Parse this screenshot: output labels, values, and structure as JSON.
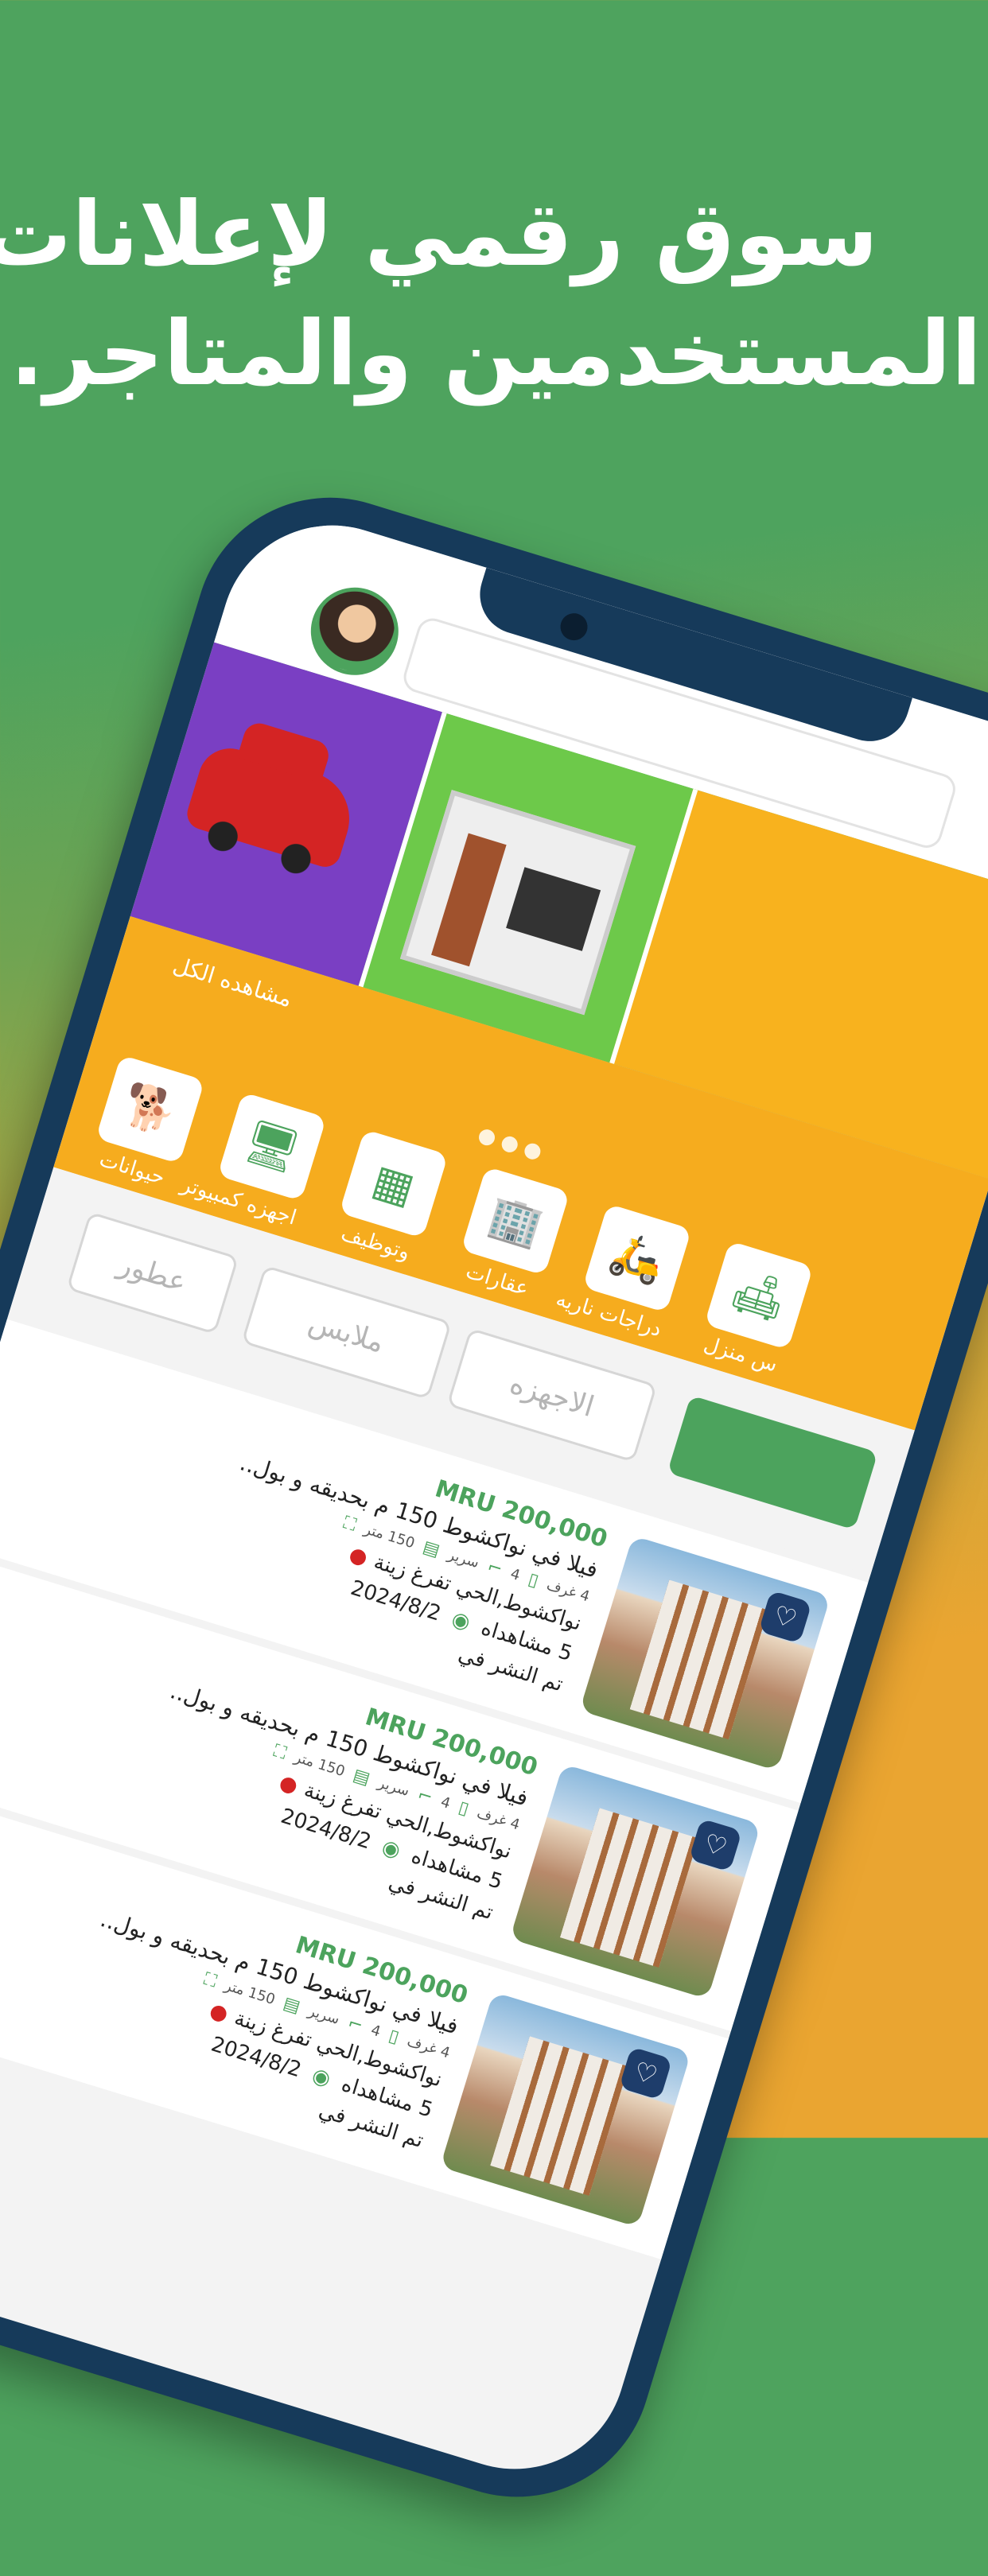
{
  "headline": {
    "line1": "سوق رقمي لإعلانات",
    "line2": "المستخدمين والمتاجر."
  },
  "colors": {
    "brand_green": "#4ca35d",
    "accent_orange": "#f6ac1e",
    "heart_navy": "#1e3d6b"
  },
  "home": {
    "see_all": "مشاهده الكل",
    "categories": [
      {
        "label": "حيوانات",
        "icon": "dog-icon",
        "glyph": "🐕"
      },
      {
        "label": "اجهزه كمبيوتر",
        "icon": "computer-icon",
        "glyph": "🖥"
      },
      {
        "label": "وتوظيف",
        "icon": "jobs-icon",
        "glyph": "▦"
      },
      {
        "label": "عقارات",
        "icon": "building-icon",
        "glyph": "🏢"
      },
      {
        "label": "دراجات ناريه",
        "icon": "motorbike-icon",
        "glyph": "🛵"
      },
      {
        "label": "س منزل",
        "icon": "sofa-icon",
        "glyph": "🛋"
      }
    ],
    "filters": [
      {
        "label": "عطور",
        "active": false
      },
      {
        "label": "ملابس",
        "active": false
      },
      {
        "label": "الاجهزه",
        "active": false
      },
      {
        "label": "",
        "active": true
      }
    ],
    "listings": [
      {
        "desc": "بول و بحديقه و بول..",
        "price": "200,000 MRU",
        "title": "فيلا في نواكشوط 150 م بحديقه و بول..",
        "rooms": "4 غرف",
        "baths": "4",
        "bed": "سرير",
        "area": "150 متر",
        "location": "نواكشوط,الحي تفرغ زينة",
        "views": "5 مشاهداه",
        "date": "2024/8/2",
        "posted_label": "تم النشر في"
      },
      {
        "desc": "بول و بحديقه و بول..",
        "price": "200,000 MRU",
        "title": "فيلا في نواكشوط 150 م بحديقه و بول..",
        "rooms": "4 غرف",
        "baths": "4",
        "bed": "سرير",
        "area": "150 متر",
        "location": "نواكشوط,الحي تفرغ زينة",
        "views": "5 مشاهداه",
        "date": "2024/8/2",
        "posted_label": "تم النشر في"
      },
      {
        "desc": "بول و بحديقه و بول..",
        "price": "200,000 MRU",
        "title": "فيلا في نواكشوط 150 م بحديقه و بول..",
        "rooms": "4 غرف",
        "baths": "4",
        "bed": "سرير",
        "area": "150 متر",
        "location": "نواكشوط,الحي تفرغ زينة",
        "views": "5 مشاهداه",
        "date": "2024/8/2",
        "posted_label": "تم النشر في"
      }
    ]
  }
}
